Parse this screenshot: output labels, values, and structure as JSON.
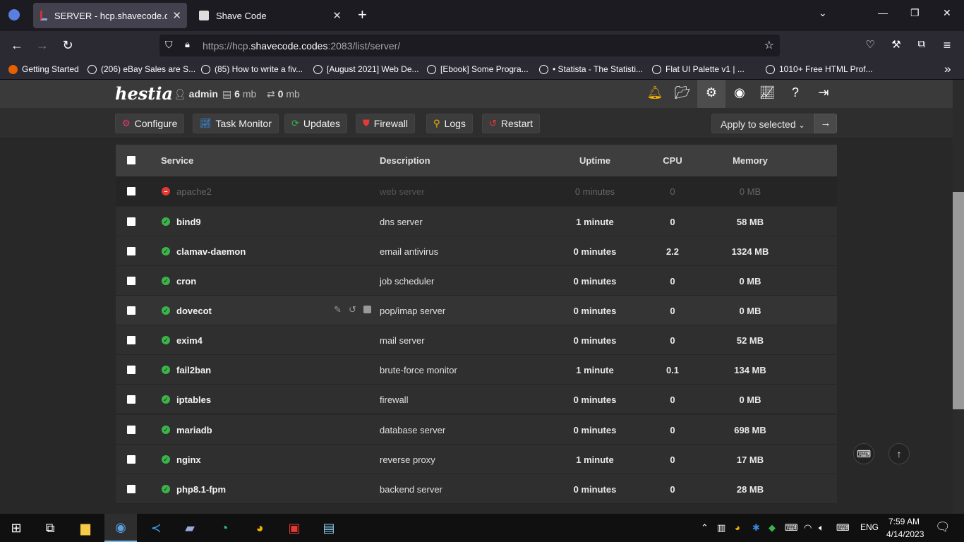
{
  "browser": {
    "tabs": [
      {
        "title": "SERVER - hcp.shavecode.codes",
        "active": true
      },
      {
        "title": "Shave Code",
        "active": false
      }
    ],
    "url_prefix": "https://hcp.",
    "url_domain": "shavecode.codes",
    "url_suffix": ":2083/list/server/",
    "bookmarks": [
      "Getting Started",
      "(206) eBay Sales are S...",
      "(85) How to write a fiv...",
      "[August 2021] Web De...",
      "[Ebook] Some Progra...",
      "• Statista - The Statisti...",
      "Flat UI Palette v1 | ...",
      "1010+ Free HTML Prof..."
    ]
  },
  "header": {
    "logo": "hestia",
    "user": "admin",
    "disk": "6",
    "disk_unit": "mb",
    "bandwidth": "0",
    "bandwidth_unit": "mb"
  },
  "toolbar": {
    "configure": "Configure",
    "task_monitor": "Task Monitor",
    "updates": "Updates",
    "firewall": "Firewall",
    "logs": "Logs",
    "restart": "Restart",
    "apply_selected": "Apply to selected"
  },
  "table": {
    "headers": {
      "service": "Service",
      "description": "Description",
      "uptime": "Uptime",
      "cpu": "CPU",
      "memory": "Memory"
    },
    "rows": [
      {
        "service": "apache2",
        "description": "web server",
        "uptime": "0 minutes",
        "cpu": "0",
        "memory": "0 MB",
        "status": "stopped"
      },
      {
        "service": "bind9",
        "description": "dns server",
        "uptime": "1 minute",
        "cpu": "0",
        "memory": "58 MB",
        "status": "running"
      },
      {
        "service": "clamav-daemon",
        "description": "email antivirus",
        "uptime": "0 minutes",
        "cpu": "2.2",
        "memory": "1324 MB",
        "status": "running"
      },
      {
        "service": "cron",
        "description": "job scheduler",
        "uptime": "0 minutes",
        "cpu": "0",
        "memory": "0 MB",
        "status": "running"
      },
      {
        "service": "dovecot",
        "description": "pop/imap server",
        "uptime": "0 minutes",
        "cpu": "0",
        "memory": "0 MB",
        "status": "running"
      },
      {
        "service": "exim4",
        "description": "mail server",
        "uptime": "0 minutes",
        "cpu": "0",
        "memory": "52 MB",
        "status": "running"
      },
      {
        "service": "fail2ban",
        "description": "brute-force monitor",
        "uptime": "1 minute",
        "cpu": "0.1",
        "memory": "134 MB",
        "status": "running"
      },
      {
        "service": "iptables",
        "description": "firewall",
        "uptime": "0 minutes",
        "cpu": "0",
        "memory": "0 MB",
        "status": "running"
      },
      {
        "service": "mariadb",
        "description": "database server",
        "uptime": "0 minutes",
        "cpu": "0",
        "memory": "698 MB",
        "status": "running"
      },
      {
        "service": "nginx",
        "description": "reverse proxy",
        "uptime": "1 minute",
        "cpu": "0",
        "memory": "17 MB",
        "status": "running"
      },
      {
        "service": "php8.1-fpm",
        "description": "backend server",
        "uptime": "0 minutes",
        "cpu": "0",
        "memory": "28 MB",
        "status": "running"
      }
    ]
  },
  "taskbar": {
    "time": "7:59 AM",
    "date": "4/14/2023",
    "lang": "ENG"
  },
  "colors": {
    "running": "#3bb54a",
    "stopped": "#e53935",
    "accent": "#76b9ed"
  }
}
